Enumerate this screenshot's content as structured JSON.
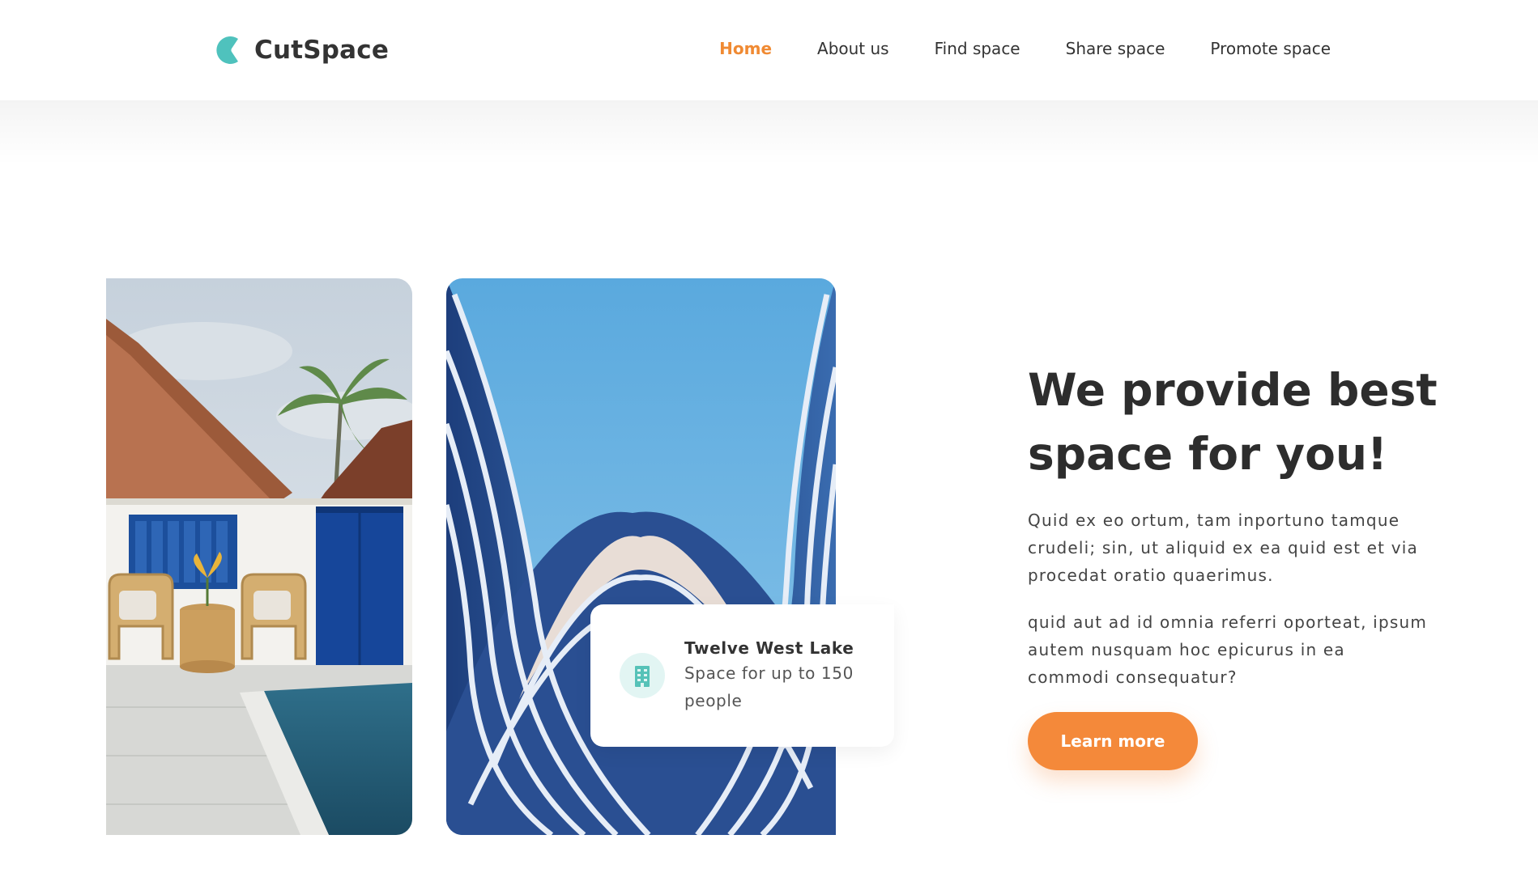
{
  "brand": {
    "name": "CutSpace",
    "logo_color": "#4fc2bd"
  },
  "nav": {
    "items": [
      {
        "label": "Home",
        "active": true
      },
      {
        "label": "About us",
        "active": false
      },
      {
        "label": "Find space",
        "active": false
      },
      {
        "label": "Share space",
        "active": false
      },
      {
        "label": "Promote space",
        "active": false
      }
    ],
    "active_color": "#f08a33"
  },
  "hero": {
    "title": "We provide best space for you!",
    "paragraph_1": "Quid ex eo ortum, tam inportuno tamque crudeli; sin, ut aliquid ex ea quid est et via procedat oratio quaerimus.",
    "paragraph_2": "quid aut ad id omnia referri oporteat, ipsum autem nusquam hoc epicurus in ea commodi consequatur?",
    "cta_label": "Learn more",
    "cta_color": "#f4893a"
  },
  "space_card": {
    "title": "Twelve West Lake",
    "description": "Space for up to 150 people",
    "icon": "building-icon"
  }
}
